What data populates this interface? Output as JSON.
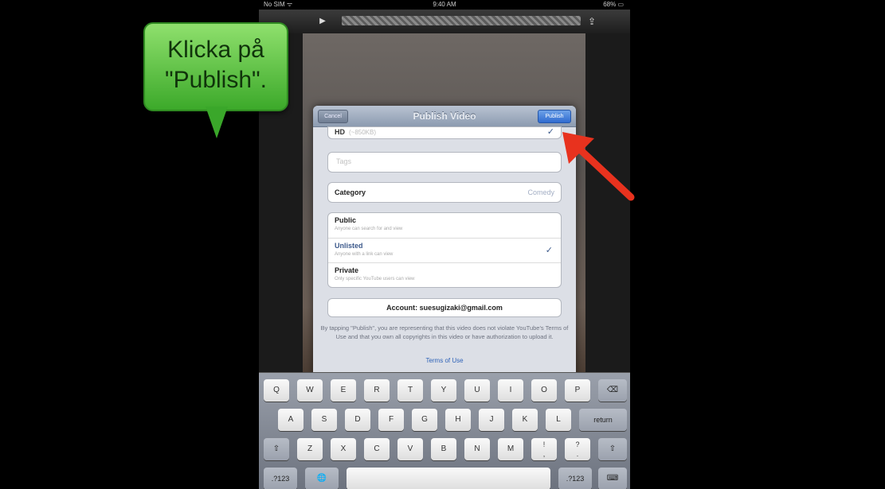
{
  "status_bar": {
    "carrier": "No SIM ᯤ",
    "time": "9:40 AM",
    "battery": "68% ▭"
  },
  "toolbar": {
    "play_icon": "play-icon",
    "share_icon": "share-icon"
  },
  "dialog": {
    "title": "Publish Video",
    "cancel_label": "Cancel",
    "publish_label": "Publish",
    "hd": {
      "label": "HD",
      "size": "(~850KB)",
      "checked": true
    },
    "tags_placeholder": "Tags",
    "category": {
      "label": "Category",
      "value": "Comedy"
    },
    "privacy": [
      {
        "title": "Public",
        "subtitle": "Anyone can search for and view",
        "checked": false
      },
      {
        "title": "Unlisted",
        "subtitle": "Anyone with a link can view",
        "checked": true
      },
      {
        "title": "Private",
        "subtitle": "Only specific YouTube users can view",
        "checked": false
      }
    ],
    "account": "Account: suesugizaki@gmail.com",
    "disclaimer": "By tapping \"Publish\", you are representing that this video does not violate YouTube's Terms of Use and that you own all copyrights in this video or have authorization to upload it.",
    "terms_link": "Terms of Use"
  },
  "keyboard": {
    "row1": [
      "Q",
      "W",
      "E",
      "R",
      "T",
      "Y",
      "U",
      "I",
      "O",
      "P",
      "⌫"
    ],
    "row2": [
      "A",
      "S",
      "D",
      "F",
      "G",
      "H",
      "J",
      "K",
      "L",
      "return"
    ],
    "row3": [
      "⇧",
      "Z",
      "X",
      "C",
      "V",
      "B",
      "N",
      "M",
      "!\n,",
      "?\n.",
      "⇧"
    ],
    "row4": [
      ".?123",
      "🌐",
      "",
      ".?123",
      "⌨"
    ]
  },
  "callout": {
    "text": "Klicka på \"Publish\"."
  },
  "colors": {
    "callout_green": "#5cc443",
    "arrow_red": "#e8321e",
    "publish_blue": "#2f6bd0"
  }
}
